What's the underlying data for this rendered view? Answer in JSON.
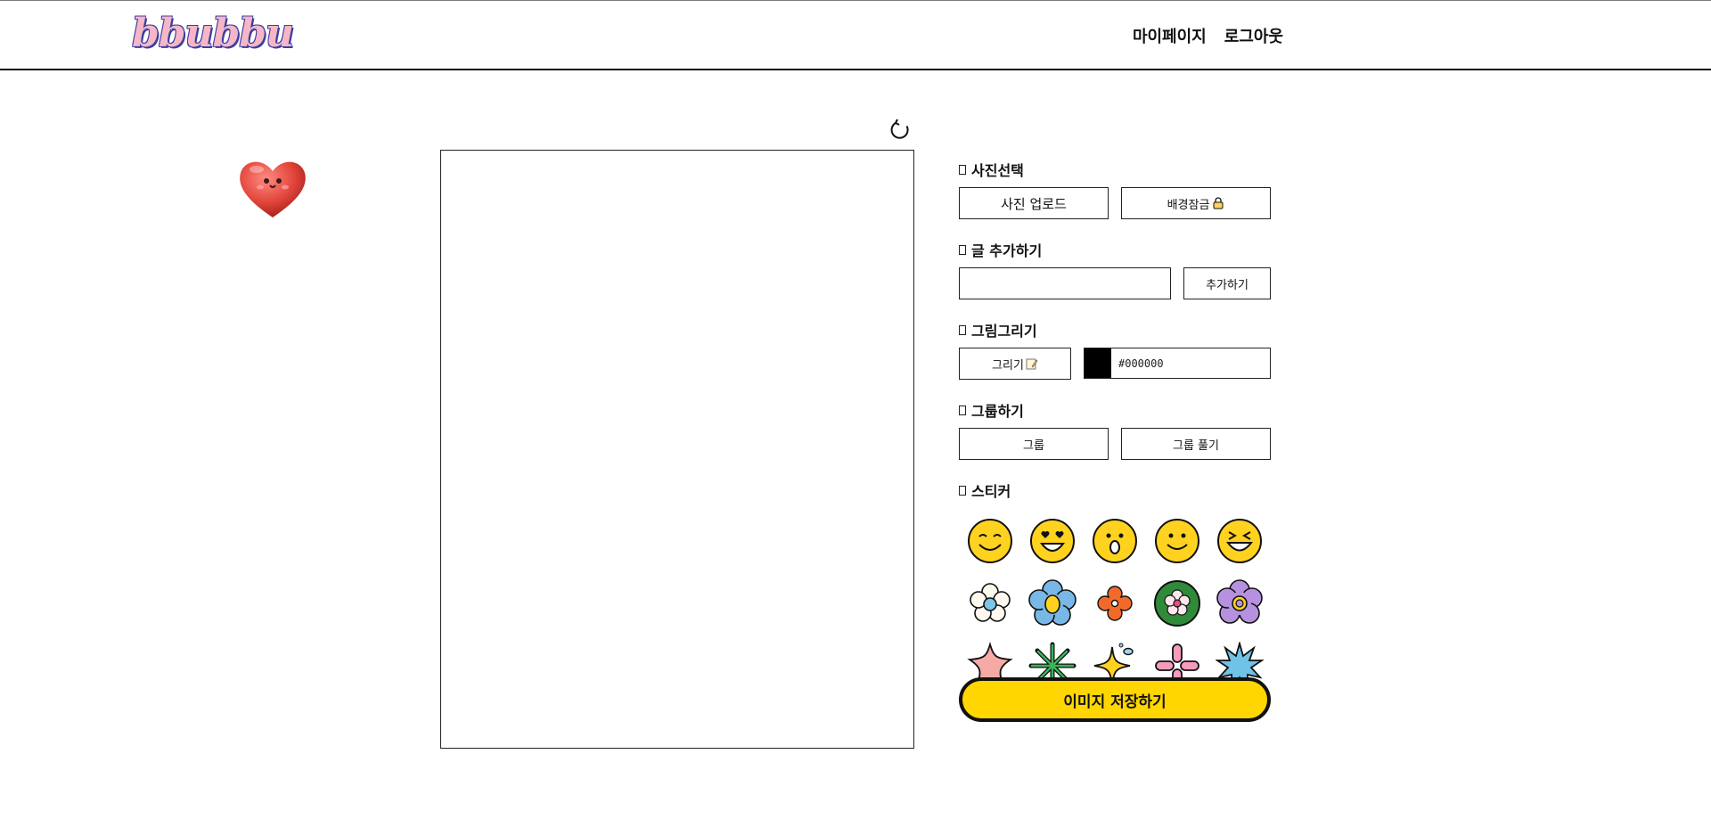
{
  "header": {
    "logo": "bbubbu",
    "nav": {
      "mypage": "마이페이지",
      "logout": "로그아웃"
    }
  },
  "panel": {
    "photo": {
      "title": "사진선택",
      "upload": "사진 업로드",
      "bg_lock": "배경잠금"
    },
    "text": {
      "title": "글 추가하기",
      "input_value": "",
      "add": "추가하기"
    },
    "draw": {
      "title": "그림그리기",
      "draw": "그리기",
      "color_hex": "#000000"
    },
    "group": {
      "title": "그룹하기",
      "group": "그룹",
      "ungroup": "그룹 풀기"
    },
    "sticker": {
      "title": "스티커",
      "items": [
        "smile-face-sticker",
        "heart-eyes-face-sticker",
        "surprised-face-sticker",
        "simple-smile-face-sticker",
        "laughing-face-sticker",
        "white-flower-sticker",
        "blue-flower-sticker",
        "orange-flower-sticker",
        "green-circle-flower-sticker",
        "purple-flower-sticker",
        "pink-star-sticker",
        "green-asterisk-sticker",
        "yellow-sparkle-sticker",
        "pink-cross-sticker",
        "blue-burst-sticker"
      ]
    },
    "save": "이미지 저장하기"
  },
  "colors": {
    "accent": "#ffd600",
    "logo_pink": "#f6b6c7",
    "logo_outline": "#3a3fa0"
  }
}
